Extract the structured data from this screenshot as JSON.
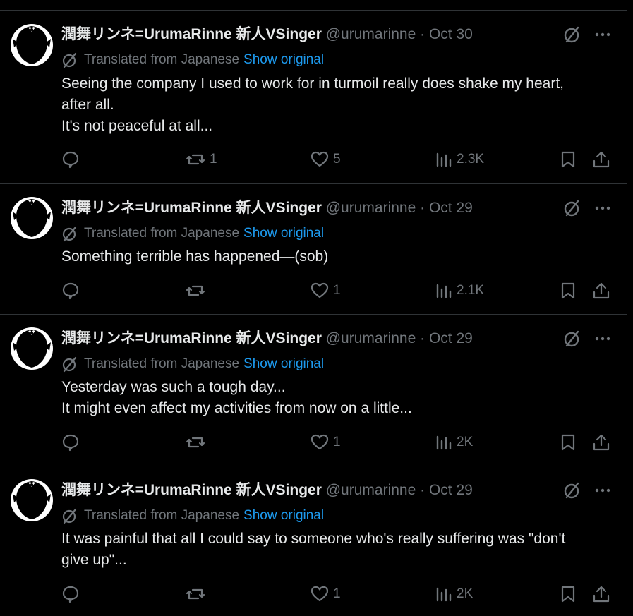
{
  "posts": [
    {
      "author_name": "潤舞リンネ=UrumaRinne 新人VSinger",
      "handle": "@urumarinne",
      "separator": "·",
      "date": "Oct 30",
      "translated_label": "Translated from Japanese",
      "show_original": "Show original",
      "text_lines": [
        "Seeing the company I used to work for in turmoil really does shake my heart,",
        "after all.",
        "It's not peaceful at all..."
      ],
      "replies": "",
      "reposts": "1",
      "likes": "5",
      "views": "2.3K"
    },
    {
      "author_name": "潤舞リンネ=UrumaRinne 新人VSinger",
      "handle": "@urumarinne",
      "separator": "·",
      "date": "Oct 29",
      "translated_label": "Translated from Japanese",
      "show_original": "Show original",
      "text_lines": [
        "Something terrible has happened—(sob)"
      ],
      "replies": "",
      "reposts": "",
      "likes": "1",
      "views": "2.1K"
    },
    {
      "author_name": "潤舞リンネ=UrumaRinne 新人VSinger",
      "handle": "@urumarinne",
      "separator": "·",
      "date": "Oct 29",
      "translated_label": "Translated from Japanese",
      "show_original": "Show original",
      "text_lines": [
        "Yesterday was such a tough day...",
        "It might even affect my activities from now on a little..."
      ],
      "replies": "",
      "reposts": "",
      "likes": "1",
      "views": "2K"
    },
    {
      "author_name": "潤舞リンネ=UrumaRinne 新人VSinger",
      "handle": "@urumarinne",
      "separator": "·",
      "date": "Oct 29",
      "translated_label": "Translated from Japanese",
      "show_original": "Show original",
      "text_lines": [
        "It was painful that all I could say to someone who's really suffering was \"don't",
        "give up\"..."
      ],
      "replies": "",
      "reposts": "",
      "likes": "1",
      "views": "2K"
    }
  ],
  "colors": {
    "background": "#000000",
    "text": "#e7e9ea",
    "muted": "#71767b",
    "link": "#1d9bf0",
    "divider": "#2f3336"
  },
  "icons": {
    "translate": "translate-slash-circle-icon",
    "more": "more-dots-icon",
    "reply": "reply-bubble-icon",
    "repost": "repost-arrows-icon",
    "like": "heart-icon",
    "views": "views-bars-icon",
    "bookmark": "bookmark-icon",
    "share": "share-upload-icon"
  }
}
